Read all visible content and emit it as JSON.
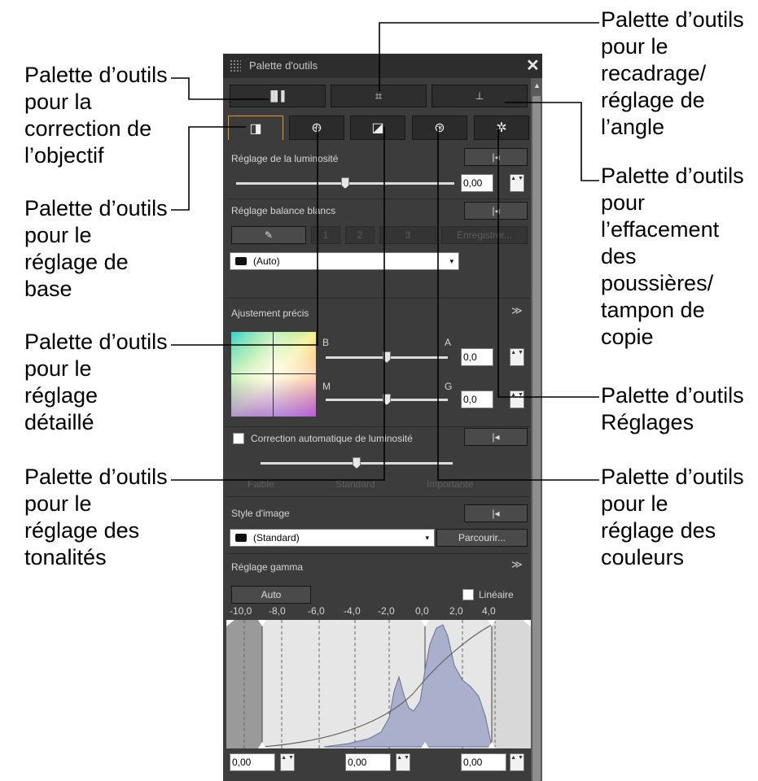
{
  "callouts": {
    "lens": "Palette d’outils\npour la\ncorrection de\nl’objectif",
    "basic": "Palette d’outils\npour le\nréglage de\nbase",
    "detail": "Palette d’outils\npour le\nréglage\ndétaillé",
    "tone": "Palette d’outils\npour le\nréglage des\ntonalités",
    "crop": "Palette d’outils\npour le\nrecadrage/\nréglage de\nl’angle",
    "dust": "Palette d’outils\npour\nl’effacement\ndes\npoussières/\ntampon de\ncopie",
    "settings": "Palette d’outils\nRéglages",
    "color": "Palette d’outils\npour le\nréglage des\ncouleurs"
  },
  "palette": {
    "title": "Palette d'outils",
    "close_glyph": "✕",
    "scroll_up_glyph": "▲",
    "top_buttons": [
      {
        "icon": "lens-correction-icon",
        "glyph": "▐▌▌"
      },
      {
        "icon": "crop-icon",
        "glyph": "⌗"
      },
      {
        "icon": "stamp-icon",
        "glyph": "⊥"
      }
    ],
    "tabs": [
      {
        "icon": "basic-adjust-icon",
        "glyph": "◨"
      },
      {
        "icon": "detail-adjust-icon",
        "glyph": "⊕"
      },
      {
        "icon": "tone-curve-icon",
        "glyph": "◪"
      },
      {
        "icon": "color-adjust-icon",
        "glyph": "⊛"
      },
      {
        "icon": "settings-icon",
        "glyph": "✲"
      }
    ],
    "reset_glyph": "|◂",
    "brightness": {
      "label": "Réglage de la luminosité",
      "value": "0,00",
      "level": 0.5
    },
    "white_balance": {
      "label": "Réglage balance blancs",
      "eyedropper_glyph": "✎",
      "presets": [
        "1",
        "2",
        "3"
      ],
      "register": "Enregistrer...",
      "select_value": "(Auto)"
    },
    "fine_tune": {
      "label": "Ajustement précis",
      "expand_glyph": "≫",
      "axis_b": "B",
      "axis_a": "A",
      "axis_m": "M",
      "axis_g": "G",
      "ba_value": "0,0",
      "mg_value": "0,0",
      "ba_level": 0.5,
      "mg_level": 0.5
    },
    "auto_brightness": {
      "label": "Correction automatique de luminosité",
      "levels": [
        "Faible",
        "Standard",
        "Importante"
      ],
      "level": 0.5
    },
    "picture_style": {
      "label": "Style d'image",
      "select_value": "(Standard)",
      "browse": "Parcourir..."
    },
    "gamma": {
      "label": "Réglage gamma",
      "expand_glyph": "≫",
      "auto": "Auto",
      "linear": "Linéaire",
      "ticks": [
        "-10,0",
        "-8,0",
        "-6,0",
        "-4,0",
        "-2,0",
        "0,0",
        "2,0",
        "4,0"
      ],
      "values": [
        "0,00",
        "0,00",
        "0,00"
      ]
    },
    "spin_glyph": "▲\n▼",
    "caret_glyph": "▾"
  }
}
